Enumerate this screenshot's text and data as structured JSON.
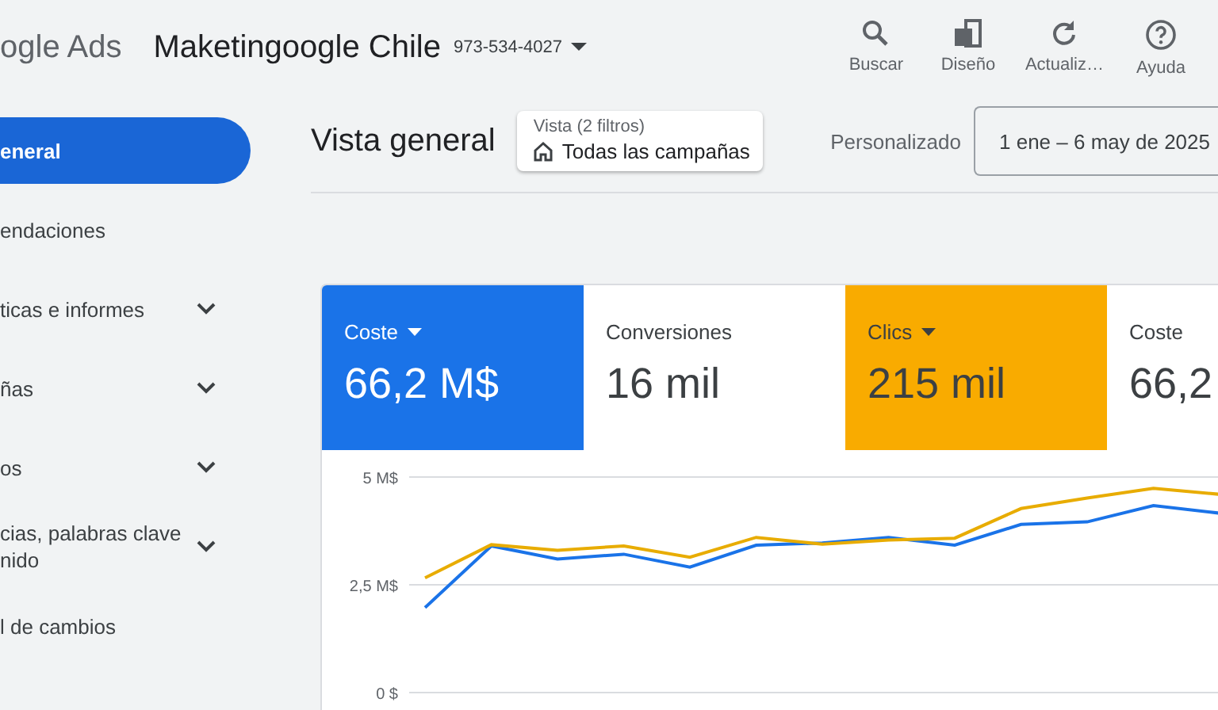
{
  "app_bar": {
    "product": "ogle Ads",
    "account_name": "Maketingoogle Chile",
    "account_id": "973-534-4027",
    "actions": [
      {
        "kind": "search",
        "label": "Buscar"
      },
      {
        "kind": "layout",
        "label": "Diseño"
      },
      {
        "kind": "refresh",
        "label": "Actualiz…"
      },
      {
        "kind": "help",
        "label": "Ayuda"
      }
    ]
  },
  "sidebar": {
    "items": [
      {
        "label": "eneral",
        "selected": true,
        "expandable": false
      },
      {
        "label": "endaciones",
        "selected": false,
        "expandable": false
      },
      {
        "label": "ticas e informes",
        "selected": false,
        "expandable": true
      },
      {
        "label": "ñas",
        "selected": false,
        "expandable": true
      },
      {
        "label": "os",
        "selected": false,
        "expandable": true
      },
      {
        "label": "cias, palabras clave\nnido",
        "selected": false,
        "expandable": true
      },
      {
        "label": "l de cambios",
        "selected": false,
        "expandable": false
      }
    ]
  },
  "header": {
    "title": "Vista general",
    "filter": {
      "caption": "Vista (2 filtros)",
      "value": "Todas las campañas"
    },
    "range_label": "Personalizado",
    "date_range": "1 ene – 6 may de 2025"
  },
  "metrics": [
    {
      "label": "Coste",
      "value": "66,2 M$",
      "selected": true,
      "color": "#1a73e8"
    },
    {
      "label": "Conversiones",
      "value": "16 mil",
      "selected": false
    },
    {
      "label": "Clics",
      "value": "215 mil",
      "selected": true,
      "color": "#f9ab00"
    },
    {
      "label": "Coste",
      "value": "66,2",
      "selected": false
    }
  ],
  "chart": {
    "chart_data": {
      "type": "line",
      "ylim": [
        0,
        5
      ],
      "yticks": [
        {
          "value": 0,
          "label": "0 $"
        },
        {
          "value": 2.5,
          "label": "2,5 M$"
        },
        {
          "value": 5,
          "label": "5 M$"
        }
      ],
      "series": [
        {
          "color": "#1a73e8",
          "values": [
            1.97,
            3.4,
            3.1,
            3.21,
            2.91,
            3.42,
            3.47,
            3.6,
            3.42,
            3.9,
            3.96,
            4.34,
            4.16
          ]
        },
        {
          "color": "#e8ac00",
          "values": [
            2.66,
            3.43,
            3.3,
            3.4,
            3.14,
            3.6,
            3.44,
            3.54,
            3.58,
            4.27,
            4.51,
            4.74,
            4.6
          ]
        }
      ]
    }
  }
}
